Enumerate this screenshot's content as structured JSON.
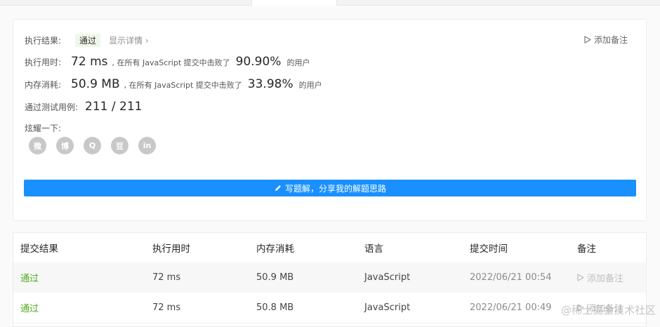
{
  "result": {
    "status_label": "执行结果:",
    "status_value": "通过",
    "detail_link": "显示详情 ›",
    "add_note": "添加备注",
    "runtime_label": "执行用时:",
    "runtime_value": "72 ms",
    "runtime_mid": ", 在所有 JavaScript 提交中击败了",
    "runtime_pct": "90.90%",
    "runtime_tail": "的用户",
    "memory_label": "内存消耗:",
    "memory_value": "50.9 MB",
    "memory_mid": ", 在所有 JavaScript 提交中击败了",
    "memory_pct": "33.98%",
    "memory_tail": "的用户",
    "tests_label": "通过测试用例:",
    "tests_value": "211 / 211",
    "share_label": "炫耀一下:",
    "share_icons": [
      "wechat-icon",
      "weibo-icon",
      "qq-icon",
      "douban-icon",
      "linkedin-icon"
    ],
    "share_glyphs": [
      "微",
      "博",
      "Q",
      "豆",
      "in"
    ],
    "write_button": "写题解，分享我的解题思路"
  },
  "table": {
    "headers": [
      "提交结果",
      "执行用时",
      "内存消耗",
      "语言",
      "提交时间",
      "备注"
    ],
    "rows": [
      {
        "status": "通过",
        "runtime": "72 ms",
        "memory": "50.9 MB",
        "language": "JavaScript",
        "time": "2022/06/21 00:54",
        "note": "添加备注"
      },
      {
        "status": "通过",
        "runtime": "72 ms",
        "memory": "50.8 MB",
        "language": "JavaScript",
        "time": "2022/06/21 00:49",
        "note": "添加备注"
      }
    ]
  },
  "watermark": "@稀土掘金技术社区",
  "colors": {
    "accent": "#1a90ff",
    "success": "#52a91e",
    "badge_bg": "#f0f7ea"
  }
}
